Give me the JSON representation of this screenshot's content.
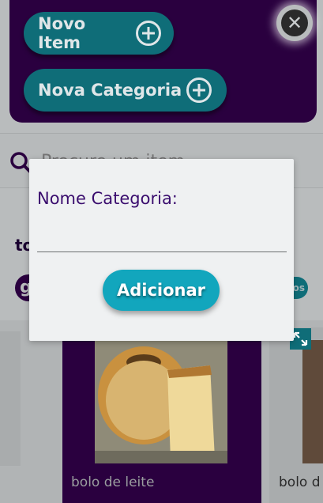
{
  "header": {
    "new_item_label": "Novo Item",
    "new_category_label": "Nova Categoria",
    "close_symbol": "✕"
  },
  "search": {
    "placeholder": "Procure um item",
    "icon": "search-icon"
  },
  "categories": {
    "title_partial": "to",
    "left_chip_partial": "g",
    "right_chip_partial": "os"
  },
  "products": [
    {
      "name": "bolo de leite"
    },
    {
      "name": "bolo d"
    }
  ],
  "modal": {
    "label": "Nome Categoria:",
    "input_value": "",
    "submit_label": "Adicionar"
  },
  "colors": {
    "panel_purple": "#2a003f",
    "button_teal": "#0f6d78",
    "accent_cyan": "#12a6bd",
    "label_purple": "#3a0d6e"
  }
}
